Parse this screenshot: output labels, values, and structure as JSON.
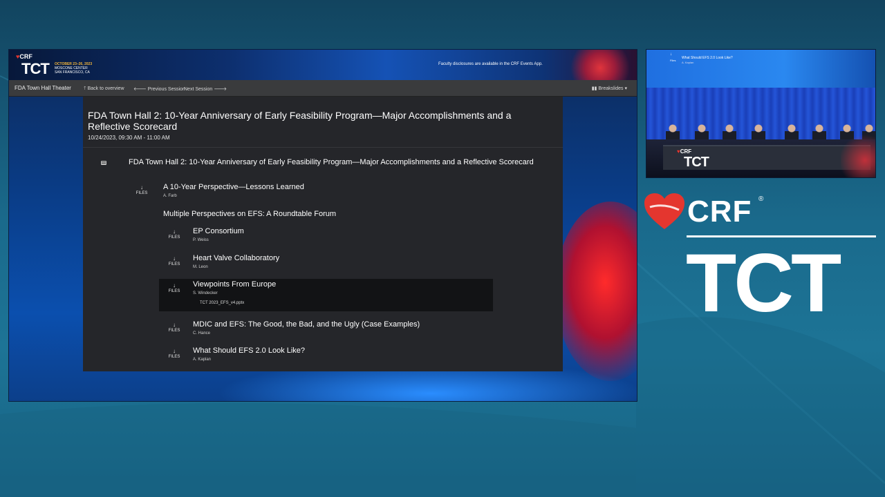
{
  "banner": {
    "crf": "CRF",
    "tct": "TCT",
    "dates": "OCTOBER 23–26, 2023",
    "venue_line1": "MOSCONE CENTER",
    "venue_line2": "SAN FRANCISCO, CA",
    "disclosure": "Faculty disclosures are available in the CRF Events App."
  },
  "navbar": {
    "brand": "FDA Town Hall Theater",
    "back": "Back to overview",
    "previous": "Previous Session",
    "next": "Next Session",
    "breakslides": "Breakslides"
  },
  "session": {
    "title": "FDA Town Hall 2: 10-Year Anniversary of Early Feasibility Program—Major Accomplishments and a Reflective Scorecard",
    "time": "10/24/2023, 09:30 AM - 11:00 AM"
  },
  "tree": {
    "root_title": "FDA Town Hall 2: 10-Year Anniversary of Early Feasibility Program—Major Accomplishments and a Reflective Scorecard",
    "files_label": "FILES",
    "items": [
      {
        "title": "A 10-Year Perspective—Lessons Learned",
        "speaker": "A. Farb"
      },
      {
        "title": "Multiple Perspectives on EFS: A Roundtable Forum"
      },
      {
        "title": "EP Consortium",
        "speaker": "P. Weiss"
      },
      {
        "title": "Heart Valve Collaboratory",
        "speaker": "M. Leon"
      },
      {
        "title": "Viewpoints From Europe",
        "speaker": "S. Windecker",
        "file": "TCT 2023_EFS_v4.pptx"
      },
      {
        "title": "MDIC and EFS: The Good, the Bad, and the Ugly (Case Examples)",
        "speaker": "C. Hance"
      },
      {
        "title": "What Should EFS 2.0 Look Like?",
        "speaker": "A. Kaplan"
      }
    ]
  },
  "camera": {
    "screen_title": "What Should EFS 2.0 Look Like?",
    "screen_speaker": "A. Kaplan",
    "screen_files": "Files",
    "table_crf": "CRF",
    "table_tct": "TCT"
  },
  "logo": {
    "crf": "CRF",
    "registered": "®",
    "tct": "TCT"
  },
  "colors": {
    "crf_red": "#e4362f",
    "panel": "#25262a",
    "navbar": "#3a3b3d",
    "backdrop": "#1a6a8c"
  }
}
